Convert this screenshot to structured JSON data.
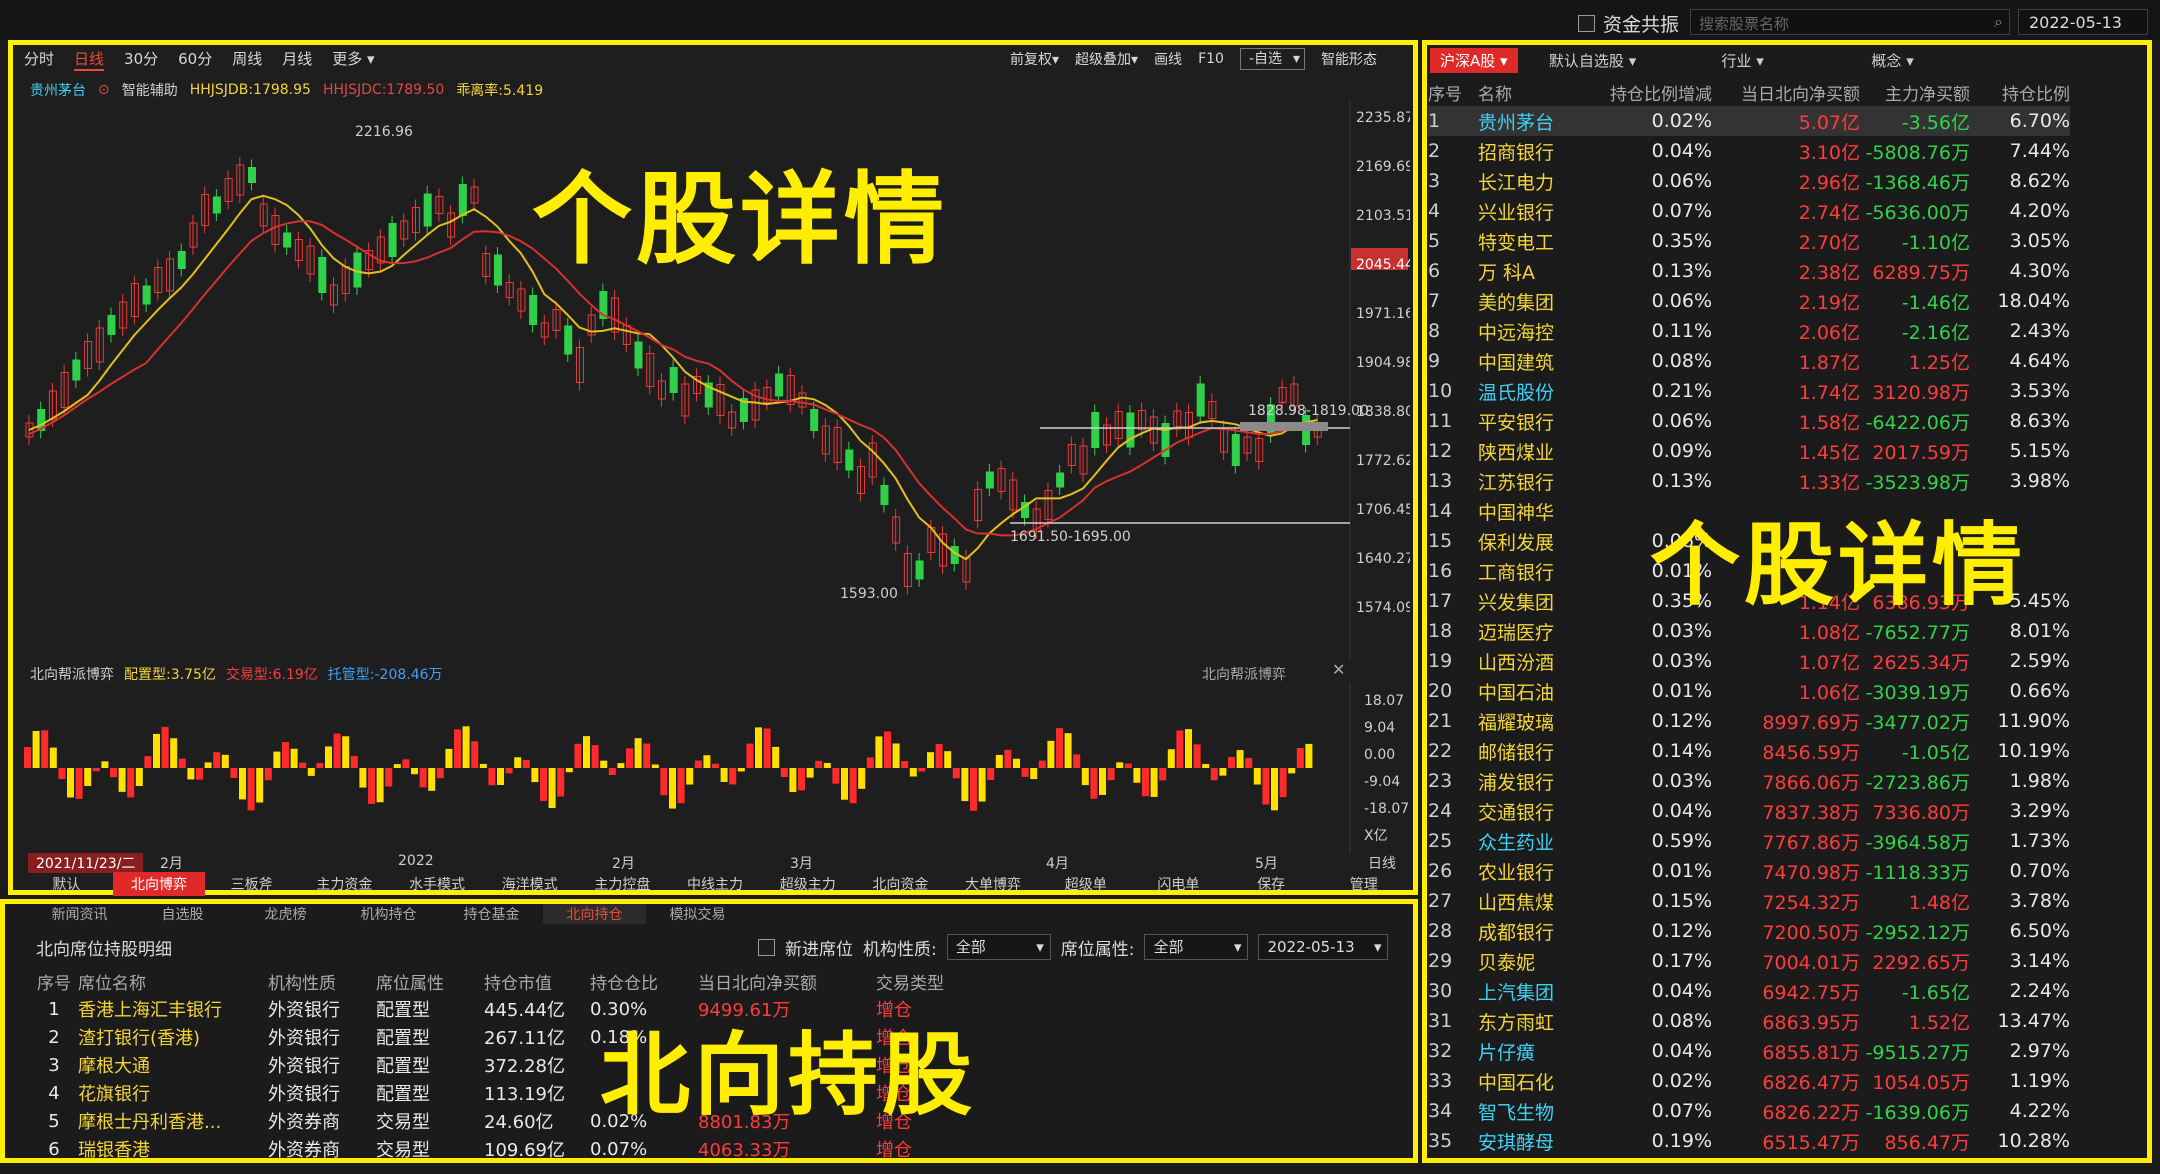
{
  "topbar": {
    "share_label": "资金共振",
    "search_placeholder": "搜索股票名称",
    "date": "2022-05-13"
  },
  "overlays": {
    "chart_title": "个股详情",
    "list_title": "个股详情",
    "north_title": "北向持股"
  },
  "chart": {
    "periods": [
      "分时",
      "日线",
      "30分",
      "60分",
      "周线",
      "月线",
      "更多"
    ],
    "active_period": "日线",
    "tools": [
      "前复权",
      "超级叠加",
      "画线",
      "F10",
      "-自选",
      "智能形态"
    ],
    "stock_name": "贵州茅台",
    "assist": "智能辅助",
    "ind1": "HHJSJDB:1798.95",
    "ind2": "HHJSJDC:1789.50",
    "ind3": "乖离率:5.419",
    "y_ticks": [
      "2235.87",
      "2169.69",
      "2103.51",
      "2045.44",
      "1971.16",
      "1904.98",
      "1838.80",
      "1772.62",
      "1706.45",
      "1640.27",
      "1574.09"
    ],
    "annot_high": "2216.96",
    "annot_low": "1593.00",
    "annot_band1": "1828.98-1819.00",
    "annot_band2": "1691.50-1695.00",
    "sub_title": "北向帮派博弈",
    "sub_peizhi": "配置型:3.75亿",
    "sub_jiaoyi": "交易型:6.19亿",
    "sub_tuoguan": "托管型:-208.46万",
    "sub_ticks": [
      "18.07",
      "9.04",
      "0.00",
      "-9.04",
      "-18.07",
      "X亿"
    ],
    "x_labels": [
      "2021/11/23/二",
      "2月",
      "2022",
      "2月",
      "3月",
      "4月",
      "5月",
      "日线"
    ],
    "bottom_tabs": [
      "默认",
      "北向博弈",
      "三板斧",
      "主力资金",
      "水手模式",
      "海洋模式",
      "主力控盘",
      "中线主力",
      "超级主力",
      "北向资金",
      "大单博弈",
      "超级单",
      "闪电单",
      "保存",
      "管理"
    ],
    "active_bottom_tab": "北向博弈"
  },
  "chart_data": {
    "type": "bar",
    "title": "北向帮派博弈",
    "ylim": [
      -18.07,
      18.07
    ]
  },
  "north": {
    "tabs": [
      "新闻资讯",
      "自选股",
      "龙虎榜",
      "机构持仓",
      "持仓基金",
      "北向持仓",
      "模拟交易"
    ],
    "active_tab": "北向持仓",
    "title": "北向席位持股明细",
    "new_seat": "新进席位",
    "org_label": "机构性质:",
    "org_value": "全部",
    "seat_label": "席位属性:",
    "seat_value": "全部",
    "date": "2022-05-13",
    "headers": [
      "序号",
      "席位名称",
      "机构性质",
      "席位属性",
      "持仓市值",
      "持仓仓比",
      "当日北向净买额",
      "交易类型"
    ],
    "rows": [
      [
        "1",
        "香港上海汇丰银行",
        "外资银行",
        "配置型",
        "445.44亿",
        "0.30%",
        "9499.61万",
        "增仓"
      ],
      [
        "2",
        "渣打银行(香港)",
        "外资银行",
        "配置型",
        "267.11亿",
        "0.18%",
        "",
        "增仓"
      ],
      [
        "3",
        "摩根大通",
        "外资银行",
        "配置型",
        "372.28亿",
        "",
        "",
        "增仓"
      ],
      [
        "4",
        "花旗银行",
        "外资银行",
        "配置型",
        "113.19亿",
        "",
        "",
        "增仓"
      ],
      [
        "5",
        "摩根士丹利香港...",
        "外资券商",
        "交易型",
        "24.60亿",
        "0.02%",
        "8801.83万",
        "增仓"
      ],
      [
        "6",
        "瑞银香港",
        "外资券商",
        "交易型",
        "109.69亿",
        "0.07%",
        "4063.33万",
        "增仓"
      ]
    ]
  },
  "list": {
    "tabs": [
      "沪深A股",
      "默认自选股",
      "行业",
      "概念"
    ],
    "headers": [
      "序号",
      "名称",
      "持仓比例增减",
      "当日北向净买额",
      "主力净买额",
      "持仓比例"
    ],
    "rows": [
      [
        "1",
        "贵州茅台",
        "0.02%",
        "5.07亿",
        "-3.56亿",
        "6.70%"
      ],
      [
        "2",
        "招商银行",
        "0.04%",
        "3.10亿",
        "-5808.76万",
        "7.44%"
      ],
      [
        "3",
        "长江电力",
        "0.06%",
        "2.96亿",
        "-1368.46万",
        "8.62%"
      ],
      [
        "4",
        "兴业银行",
        "0.07%",
        "2.74亿",
        "-5636.00万",
        "4.20%"
      ],
      [
        "5",
        "特变电工",
        "0.35%",
        "2.70亿",
        "-1.10亿",
        "3.05%"
      ],
      [
        "6",
        "万 科A",
        "0.13%",
        "2.38亿",
        "6289.75万",
        "4.30%"
      ],
      [
        "7",
        "美的集团",
        "0.06%",
        "2.19亿",
        "-1.46亿",
        "18.04%"
      ],
      [
        "8",
        "中远海控",
        "0.11%",
        "2.06亿",
        "-2.16亿",
        "2.43%"
      ],
      [
        "9",
        "中国建筑",
        "0.08%",
        "1.87亿",
        "1.25亿",
        "4.64%"
      ],
      [
        "10",
        "温氏股份",
        "0.21%",
        "1.74亿",
        "3120.98万",
        "3.53%"
      ],
      [
        "11",
        "平安银行",
        "0.06%",
        "1.58亿",
        "-6422.06万",
        "8.63%"
      ],
      [
        "12",
        "陕西煤业",
        "0.09%",
        "1.45亿",
        "2017.59万",
        "5.15%"
      ],
      [
        "13",
        "江苏银行",
        "0.13%",
        "1.33亿",
        "-3523.98万",
        "3.98%"
      ],
      [
        "14",
        "中国神华",
        "",
        "",
        "",
        ""
      ],
      [
        "15",
        "保利发展",
        "0.06%",
        "",
        "",
        ""
      ],
      [
        "16",
        "工商银行",
        "0.01%",
        "",
        "",
        ""
      ],
      [
        "17",
        "兴发集团",
        "0.35%",
        "1.14亿",
        "6386.93万",
        "5.45%"
      ],
      [
        "18",
        "迈瑞医疗",
        "0.03%",
        "1.08亿",
        "-7652.77万",
        "8.01%"
      ],
      [
        "19",
        "山西汾酒",
        "0.03%",
        "1.07亿",
        "2625.34万",
        "2.59%"
      ],
      [
        "20",
        "中国石油",
        "0.01%",
        "1.06亿",
        "-3039.19万",
        "0.66%"
      ],
      [
        "21",
        "福耀玻璃",
        "0.12%",
        "8997.69万",
        "-3477.02万",
        "11.90%"
      ],
      [
        "22",
        "邮储银行",
        "0.14%",
        "8456.59万",
        "-1.05亿",
        "10.19%"
      ],
      [
        "23",
        "浦发银行",
        "0.03%",
        "7866.06万",
        "-2723.86万",
        "1.98%"
      ],
      [
        "24",
        "交通银行",
        "0.04%",
        "7837.38万",
        "7336.80万",
        "3.29%"
      ],
      [
        "25",
        "众生药业",
        "0.59%",
        "7767.86万",
        "-3964.58万",
        "1.73%"
      ],
      [
        "26",
        "农业银行",
        "0.01%",
        "7470.98万",
        "-1118.33万",
        "0.70%"
      ],
      [
        "27",
        "山西焦煤",
        "0.15%",
        "7254.32万",
        "1.48亿",
        "3.78%"
      ],
      [
        "28",
        "成都银行",
        "0.12%",
        "7200.50万",
        "-2952.12万",
        "6.50%"
      ],
      [
        "29",
        "贝泰妮",
        "0.17%",
        "7004.01万",
        "2292.65万",
        "3.14%"
      ],
      [
        "30",
        "上汽集团",
        "0.04%",
        "6942.75万",
        "-1.65亿",
        "2.24%"
      ],
      [
        "31",
        "东方雨虹",
        "0.08%",
        "6863.95万",
        "1.52亿",
        "13.47%"
      ],
      [
        "32",
        "片仔癀",
        "0.04%",
        "6855.81万",
        "-9515.27万",
        "2.97%"
      ],
      [
        "33",
        "中国石化",
        "0.02%",
        "6826.47万",
        "1054.05万",
        "1.19%"
      ],
      [
        "34",
        "智飞生物",
        "0.07%",
        "6826.22万",
        "-1639.06万",
        "4.22%"
      ],
      [
        "35",
        "安琪酵母",
        "0.19%",
        "6515.47万",
        "856.47万",
        "10.28%"
      ]
    ]
  }
}
